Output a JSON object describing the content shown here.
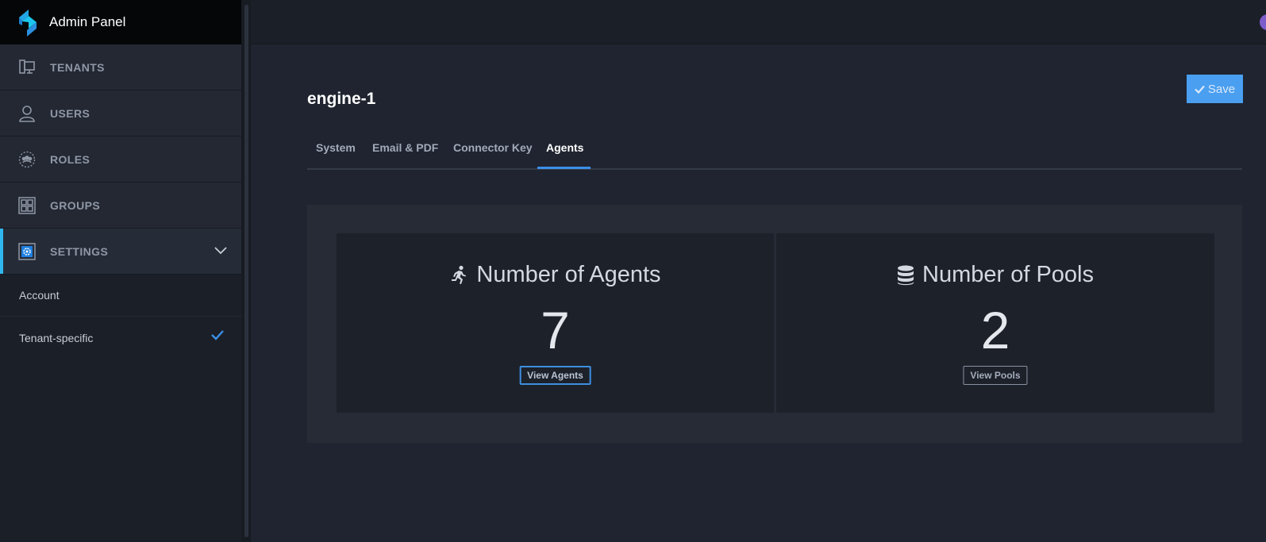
{
  "app": {
    "title": "Admin Panel"
  },
  "sidebar": {
    "items": [
      {
        "label": "TENANTS",
        "icon": "monitor-icon"
      },
      {
        "label": "USERS",
        "icon": "user-icon"
      },
      {
        "label": "ROLES",
        "icon": "roles-icon"
      },
      {
        "label": "GROUPS",
        "icon": "grid-icon"
      },
      {
        "label": "SETTINGS",
        "icon": "gear-icon",
        "active": true,
        "expanded": true
      }
    ],
    "subitems": [
      {
        "label": "Account",
        "checked": false
      },
      {
        "label": "Tenant-specific",
        "checked": true
      }
    ]
  },
  "page": {
    "title": "engine-1",
    "save_label": "Save"
  },
  "tabs": [
    {
      "label": "System"
    },
    {
      "label": "Email & PDF"
    },
    {
      "label": "Connector Key"
    },
    {
      "label": "Agents",
      "active": true
    }
  ],
  "cards": [
    {
      "title": "Number of Agents",
      "value": "7",
      "button": "View Agents",
      "icon": "runner-icon"
    },
    {
      "title": "Number of Pools",
      "value": "2",
      "button": "View Pools",
      "icon": "database-icon"
    }
  ],
  "colors": {
    "accent": "#2fb8f0",
    "primary_button": "#4a9ff0",
    "tab_active_underline": "#3b8fe8"
  }
}
